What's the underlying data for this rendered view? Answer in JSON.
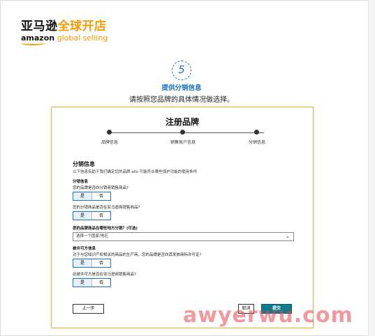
{
  "logo": {
    "cn_dark": "亚马逊",
    "cn_orange": "全球开店",
    "en_brand": "amazon",
    "en_sub": "global selling"
  },
  "step": {
    "number": "5",
    "title": "提供分销信息",
    "subtitle": "请按照您品牌的具体情况做选择。"
  },
  "card": {
    "title": "注册品牌",
    "progress": [
      "品牌信息",
      "销售账户信息",
      "分销信息"
    ],
    "section_title": "分销信息",
    "section_desc": "以下信息有助于我们确定您的品牌 allo 可能符合哪些保护功能的使用条件",
    "q1_label": "分销信息",
    "q1_text": "您的品牌是否向分销商销售商品?",
    "q2_text": "您的分销商品是否在亚马逊商销售商品?",
    "q3_label": "您的品牌商品在哪些地方分销？(可选)",
    "select_placeholder": "选择一个国家/地区",
    "q4_label": "被许可方信息",
    "q4_text": "对于与您知识产权相关的商品的生产商，您的品牌是否向其发放商标许可证?",
    "q5_text": "此被许可方是否在亚马逊商销售商品?",
    "yes": "是",
    "no": "否",
    "btn_back": "上一步",
    "btn_cancel": "取消",
    "btn_submit": "提交"
  },
  "watermark": "awyerwu.com",
  "colors": {
    "accent": "#1a73c8",
    "card_border": "#f0a830",
    "submit": "#137a8a",
    "brand_orange": "#ff9900"
  }
}
